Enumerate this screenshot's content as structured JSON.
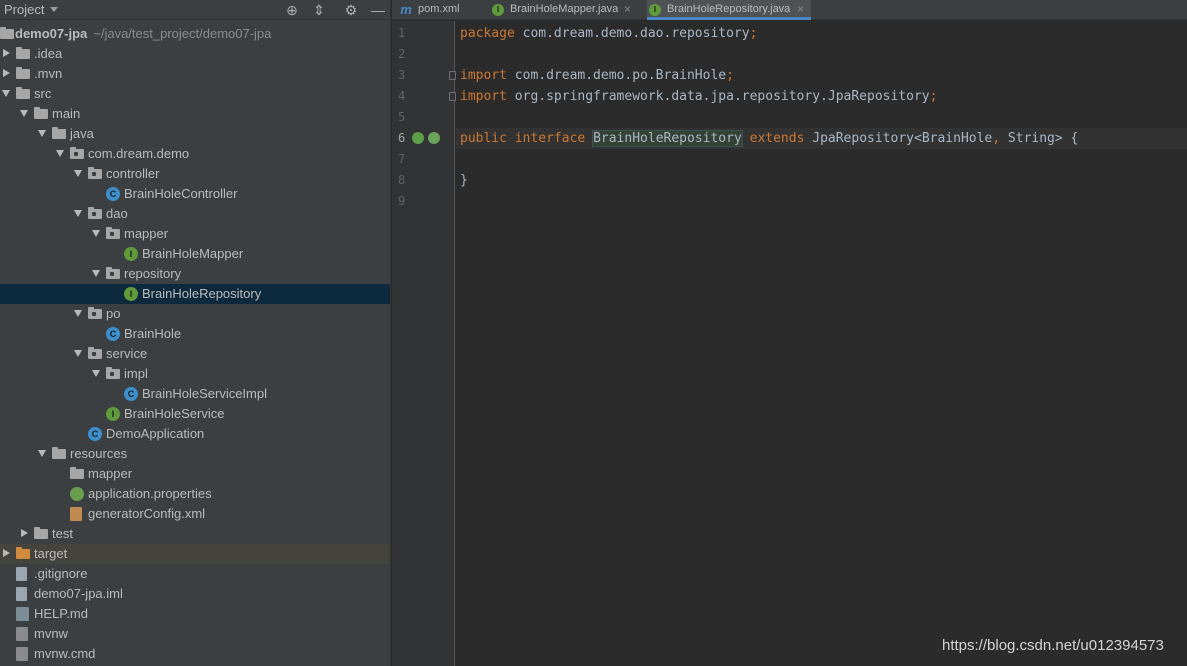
{
  "project_panel": {
    "title": "Project",
    "tree": [
      {
        "label": "demo07-jpa",
        "sub": "~/java/test_project/demo07-jpa",
        "icon": "folder-icon",
        "arrow": "open",
        "depth": 0,
        "root": true
      },
      {
        "label": ".idea",
        "icon": "folder-icon",
        "arrow": "closed",
        "depth": 1
      },
      {
        "label": ".mvn",
        "icon": "folder-icon",
        "arrow": "closed",
        "depth": 1
      },
      {
        "label": "src",
        "icon": "folder-icon",
        "arrow": "open",
        "depth": 1
      },
      {
        "label": "main",
        "icon": "folder-icon",
        "arrow": "open",
        "depth": 2
      },
      {
        "label": "java",
        "icon": "folder-icon",
        "arrow": "open",
        "depth": 3
      },
      {
        "label": "com.dream.demo",
        "icon": "package-icon",
        "arrow": "open",
        "depth": 4
      },
      {
        "label": "controller",
        "icon": "package-icon",
        "arrow": "open",
        "depth": 5
      },
      {
        "label": "BrainHoleController",
        "icon": "class-icon",
        "depth": 6
      },
      {
        "label": "dao",
        "icon": "package-icon",
        "arrow": "open",
        "depth": 5
      },
      {
        "label": "mapper",
        "icon": "package-icon",
        "arrow": "open",
        "depth": 6
      },
      {
        "label": "BrainHoleMapper",
        "icon": "interface-icon",
        "depth": 7
      },
      {
        "label": "repository",
        "icon": "package-icon",
        "arrow": "open",
        "depth": 6
      },
      {
        "label": "BrainHoleRepository",
        "icon": "interface-icon",
        "depth": 7,
        "selected": true
      },
      {
        "label": "po",
        "icon": "package-icon",
        "arrow": "open",
        "depth": 5
      },
      {
        "label": "BrainHole",
        "icon": "class-icon",
        "depth": 6
      },
      {
        "label": "service",
        "icon": "package-icon",
        "arrow": "open",
        "depth": 5
      },
      {
        "label": "impl",
        "icon": "package-icon",
        "arrow": "open",
        "depth": 6
      },
      {
        "label": "BrainHoleServiceImpl",
        "icon": "class-icon",
        "depth": 7
      },
      {
        "label": "BrainHoleService",
        "icon": "interface-icon",
        "depth": 6
      },
      {
        "label": "DemoApplication",
        "icon": "spring-app-icon",
        "depth": 5
      },
      {
        "label": "resources",
        "icon": "resources-folder-icon",
        "arrow": "open",
        "depth": 3
      },
      {
        "label": "mapper",
        "icon": "folder-icon",
        "depth": 4
      },
      {
        "label": "application.properties",
        "icon": "spring-properties-icon",
        "depth": 4
      },
      {
        "label": "generatorConfig.xml",
        "icon": "xml-file-icon",
        "depth": 4
      },
      {
        "label": "test",
        "icon": "folder-icon",
        "arrow": "closed",
        "depth": 2
      },
      {
        "label": "target",
        "icon": "excluded-folder-icon",
        "arrow": "closed",
        "depth": 1,
        "highlight": true
      },
      {
        "label": ".gitignore",
        "icon": "gitignore-file-icon",
        "depth": 1
      },
      {
        "label": "demo07-jpa.iml",
        "icon": "iml-file-icon",
        "depth": 1
      },
      {
        "label": "HELP.md",
        "icon": "markdown-file-icon",
        "depth": 1
      },
      {
        "label": "mvnw",
        "icon": "shell-file-icon",
        "depth": 1
      },
      {
        "label": "mvnw.cmd",
        "icon": "cmd-file-icon",
        "depth": 1
      }
    ]
  },
  "tabs": [
    {
      "label": "pom.xml",
      "icon": "maven-icon",
      "badge": "m"
    },
    {
      "label": "BrainHoleMapper.java",
      "icon": "interface-icon",
      "badge": "I"
    },
    {
      "label": "BrainHoleRepository.java",
      "icon": "interface-icon",
      "badge": "I",
      "active": true
    }
  ],
  "editor": {
    "current_line": 6,
    "lines": [
      {
        "n": "1",
        "tokens": [
          [
            "kw",
            "package"
          ],
          [
            "t",
            " com.dream.demo.dao.repository"
          ],
          [
            "kw",
            ";"
          ]
        ]
      },
      {
        "n": "2",
        "tokens": []
      },
      {
        "n": "3",
        "tokens": [
          [
            "kw",
            "import"
          ],
          [
            "t",
            " com.dream.demo.po.BrainHole"
          ],
          [
            "kw",
            ";"
          ]
        ]
      },
      {
        "n": "4",
        "tokens": [
          [
            "kw",
            "import"
          ],
          [
            "t",
            " org.springframework.data.jpa.repository.JpaRepository"
          ],
          [
            "kw",
            ";"
          ]
        ]
      },
      {
        "n": "5",
        "tokens": []
      },
      {
        "n": "6",
        "tokens": [
          [
            "kw",
            "public"
          ],
          [
            "t",
            " "
          ],
          [
            "kw",
            "interface"
          ],
          [
            "t",
            " "
          ],
          [
            "hl",
            "BrainHoleRepository"
          ],
          [
            "t",
            " "
          ],
          [
            "kw",
            "extends"
          ],
          [
            "t",
            " JpaRepository<BrainHole"
          ],
          [
            "kw",
            ","
          ],
          [
            "t",
            " String> {"
          ]
        ]
      },
      {
        "n": "7",
        "tokens": []
      },
      {
        "n": "8",
        "tokens": [
          [
            "t",
            "}"
          ]
        ]
      },
      {
        "n": "9",
        "tokens": []
      }
    ]
  },
  "watermark": "https://blog.csdn.net/u012394573",
  "colors": {
    "keyword": "#cc7832",
    "text": "#a9b7c6",
    "selection": "#0d293e",
    "class_icon": "#3d8fcc",
    "interface_icon": "#5f9a3b"
  }
}
